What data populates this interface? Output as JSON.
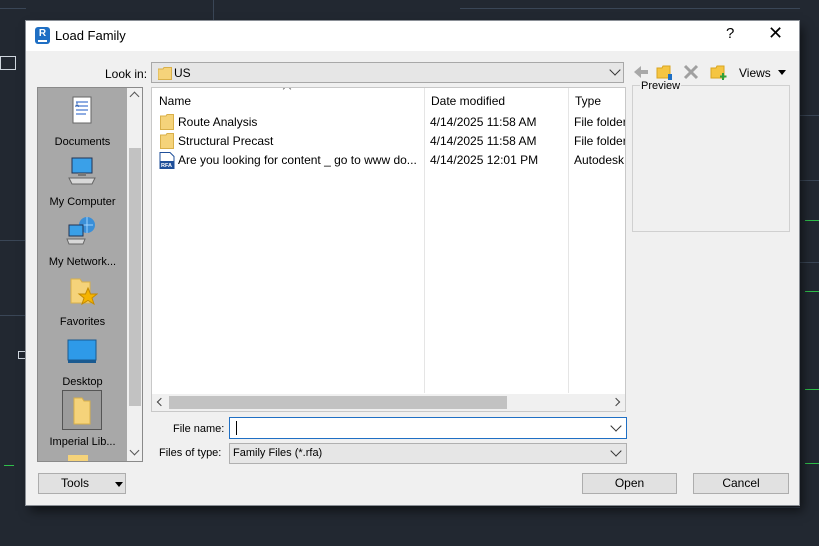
{
  "window": {
    "title": "Load Family",
    "app_icon_letter": "R",
    "help_glyph": "?",
    "close_glyph": "✕"
  },
  "look_in": {
    "label": "Look in:",
    "value": "US"
  },
  "toolbar": {
    "views_label": "Views"
  },
  "places": [
    {
      "label": "Documents",
      "icon": "documents-icon"
    },
    {
      "label": "My Computer",
      "icon": "computer-icon"
    },
    {
      "label": "My Network...",
      "icon": "network-icon"
    },
    {
      "label": "Favorites",
      "icon": "favorites-icon"
    },
    {
      "label": "Desktop",
      "icon": "desktop-icon"
    },
    {
      "label": "Imperial Lib...",
      "icon": "folder-icon"
    }
  ],
  "file_list": {
    "columns": [
      "Name",
      "Date modified",
      "Type"
    ],
    "rows": [
      {
        "name": "Route Analysis",
        "date": "4/14/2025 11:58 AM",
        "type": "File folder",
        "icon": "folder-icon"
      },
      {
        "name": "Structural Precast",
        "date": "4/14/2025 11:58 AM",
        "type": "File folder",
        "icon": "folder-icon"
      },
      {
        "name": "Are you looking for content _ go to www do...",
        "date": "4/14/2025 12:01 PM",
        "type": "Autodesk",
        "icon": "rfa-file-icon"
      }
    ]
  },
  "preview": {
    "label": "Preview"
  },
  "file_name": {
    "label": "File name:",
    "value": ""
  },
  "file_type": {
    "label": "Files of type:",
    "value": "Family Files (*.rfa)"
  },
  "buttons": {
    "tools": "Tools",
    "open": "Open",
    "cancel": "Cancel"
  },
  "colors": {
    "accent": "#1f6fc4",
    "folder": "#f5d37a",
    "dialog_bg": "#f0f0f0",
    "places_bg": "#a8a8a8"
  }
}
